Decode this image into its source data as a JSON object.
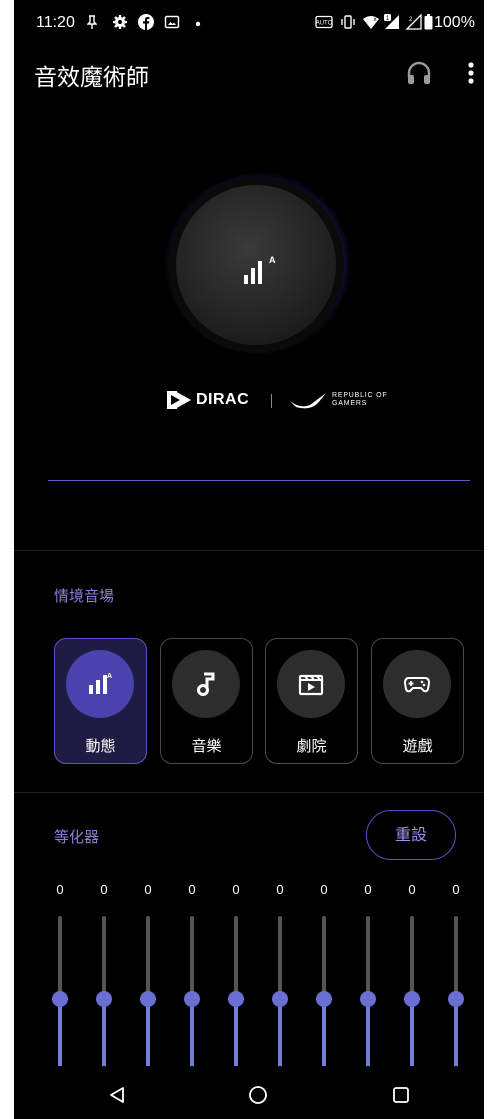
{
  "status_bar": {
    "time": "11:20",
    "battery_percent": "100%"
  },
  "app_bar": {
    "title": "音效魔術師",
    "headphone_icon": "headphones-icon",
    "more_icon": "more-vert-icon"
  },
  "hero": {
    "mode_icon": "equalizer-auto-icon",
    "badge_letter": "A",
    "dirac_logo_text": "DIRAC",
    "rog_logo_line1": "REPUBLIC OF",
    "rog_logo_line2": "GAMERS"
  },
  "scenarios": {
    "label": "情境音場",
    "items": [
      {
        "label": "動態",
        "icon": "equalizer-auto-icon",
        "active": true
      },
      {
        "label": "音樂",
        "icon": "music-note-icon",
        "active": false
      },
      {
        "label": "劇院",
        "icon": "movie-clapper-icon",
        "active": false
      },
      {
        "label": "遊戲",
        "icon": "gamepad-icon",
        "active": false
      }
    ]
  },
  "equalizer": {
    "label": "等化器",
    "reset_label": "重設",
    "bands": [
      "0",
      "0",
      "0",
      "0",
      "0",
      "0",
      "0",
      "0",
      "0",
      "0"
    ]
  },
  "colors": {
    "accent": "#5e54c6",
    "accent_text": "#8a7fd6",
    "background": "#000000"
  }
}
